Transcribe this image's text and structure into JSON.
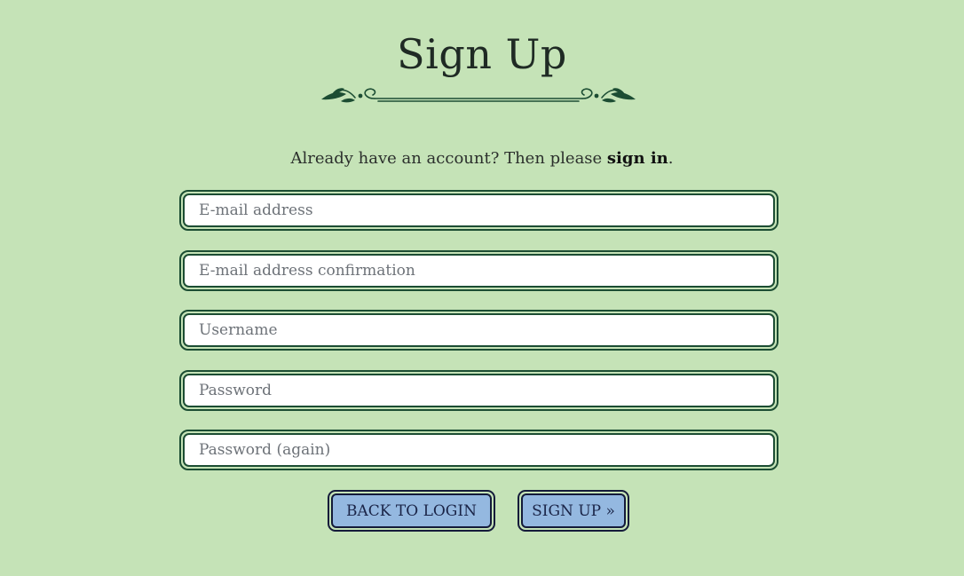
{
  "header": {
    "title": "Sign Up"
  },
  "signin_prompt": {
    "text": "Already have an account? Then please ",
    "link_label": "sign in",
    "suffix": "."
  },
  "form": {
    "email_placeholder": "E-mail address",
    "email_confirm_placeholder": "E-mail address confirmation",
    "username_placeholder": "Username",
    "password_placeholder": "Password",
    "password_again_placeholder": "Password (again)"
  },
  "actions": {
    "back_label": "BACK TO LOGIN",
    "signup_label": "SIGN UP »"
  },
  "colors": {
    "background": "#c5e3b7",
    "field_border": "#1c4d33",
    "button_fill": "#94b8e0",
    "button_border": "#141b3a"
  },
  "icons": {
    "divider": "ornamental-flourish-icon"
  }
}
